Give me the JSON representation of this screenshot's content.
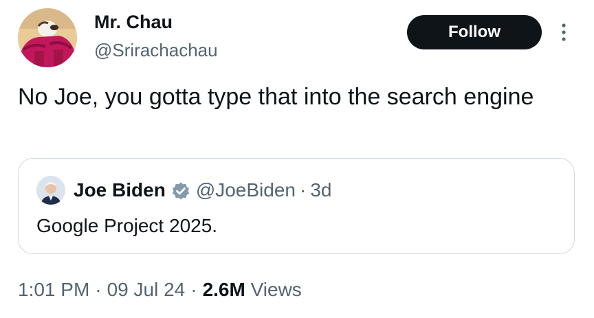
{
  "author": {
    "name": "Mr. Chau",
    "handle": "@Srirachachau",
    "avatar_icon": "cartoon-avatar"
  },
  "actions": {
    "follow_label": "Follow",
    "more_icon": "more-vertical-icon"
  },
  "tweet": {
    "text": "No Joe, you gotta type that into the search engine"
  },
  "quoted": {
    "name": "Joe Biden",
    "verified_icon": "verified-badge-icon",
    "handle": "@JoeBiden",
    "separator": "·",
    "age": "3d",
    "text": "Google Project 2025."
  },
  "meta": {
    "time": "1:01 PM",
    "separator": "·",
    "date": "09 Jul 24",
    "views_count": "2.6M",
    "views_label": "Views"
  },
  "colors": {
    "text_primary": "#0f1419",
    "text_secondary": "#536471",
    "border": "#cfd9de",
    "follow_bg": "#0f1419",
    "verified": "#829aab"
  }
}
